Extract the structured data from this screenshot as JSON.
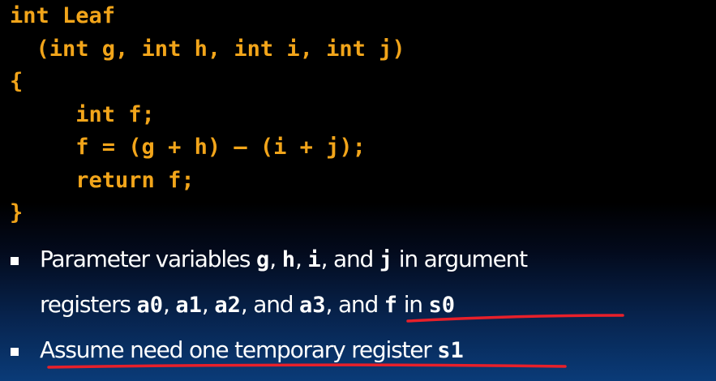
{
  "code": {
    "lines": [
      "int Leaf",
      "  (int g, int h, int i, int j)",
      "{",
      "     int f;",
      "     f = (g + h) – (i + j);",
      "     return f;",
      "}"
    ]
  },
  "bullets": {
    "b1": {
      "t1": "Parameter variables ",
      "g": "g",
      "sep1": ", ",
      "h": "h",
      "sep2": ", ",
      "i": "i",
      "t2": ", and ",
      "j": "j",
      "t3": " in argument",
      "t4": "registers ",
      "a0": "a0",
      "sep3": ", ",
      "a1": "a1",
      "sep4": ", ",
      "a2": "a2",
      "t5": ", and ",
      "a3": "a3",
      "t6": ", and ",
      "f": "f",
      "t7": " in ",
      "s0": "s0"
    },
    "b2": {
      "t1": "Assume need one temporary register ",
      "s1": "s1"
    }
  },
  "annotations": {
    "underline_color": "#e8202a"
  }
}
